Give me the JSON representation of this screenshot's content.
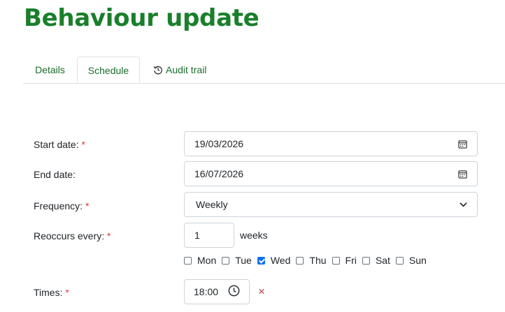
{
  "page": {
    "title": "Behaviour update"
  },
  "tabs": [
    {
      "label": "Details"
    },
    {
      "label": "Schedule"
    },
    {
      "label": "Audit trail",
      "icon": "history-icon"
    }
  ],
  "form": {
    "start_date": {
      "label": "Start date:",
      "required_mark": "*",
      "value": "19/03/2026"
    },
    "end_date": {
      "label": "End date:",
      "value": "16/07/2026"
    },
    "frequency": {
      "label": "Frequency:",
      "required_mark": "*",
      "value": "Weekly"
    },
    "reoccurs": {
      "label": "Reoccurs every:",
      "required_mark": "*",
      "value": "1",
      "unit": "weeks"
    },
    "days": [
      {
        "label": "Mon",
        "checked": false
      },
      {
        "label": "Tue",
        "checked": false
      },
      {
        "label": "Wed",
        "checked": true
      },
      {
        "label": "Thu",
        "checked": false
      },
      {
        "label": "Fri",
        "checked": false
      },
      {
        "label": "Sat",
        "checked": false
      },
      {
        "label": "Sun",
        "checked": false
      }
    ],
    "times": {
      "label": "Times:",
      "required_mark": "*",
      "value": "18:00",
      "remove_symbol": "×"
    }
  },
  "colors": {
    "title": "#1a7f2b",
    "required": "#dc3545",
    "checkbox_checked": "#0d6efd",
    "remove": "#c53b4c"
  }
}
